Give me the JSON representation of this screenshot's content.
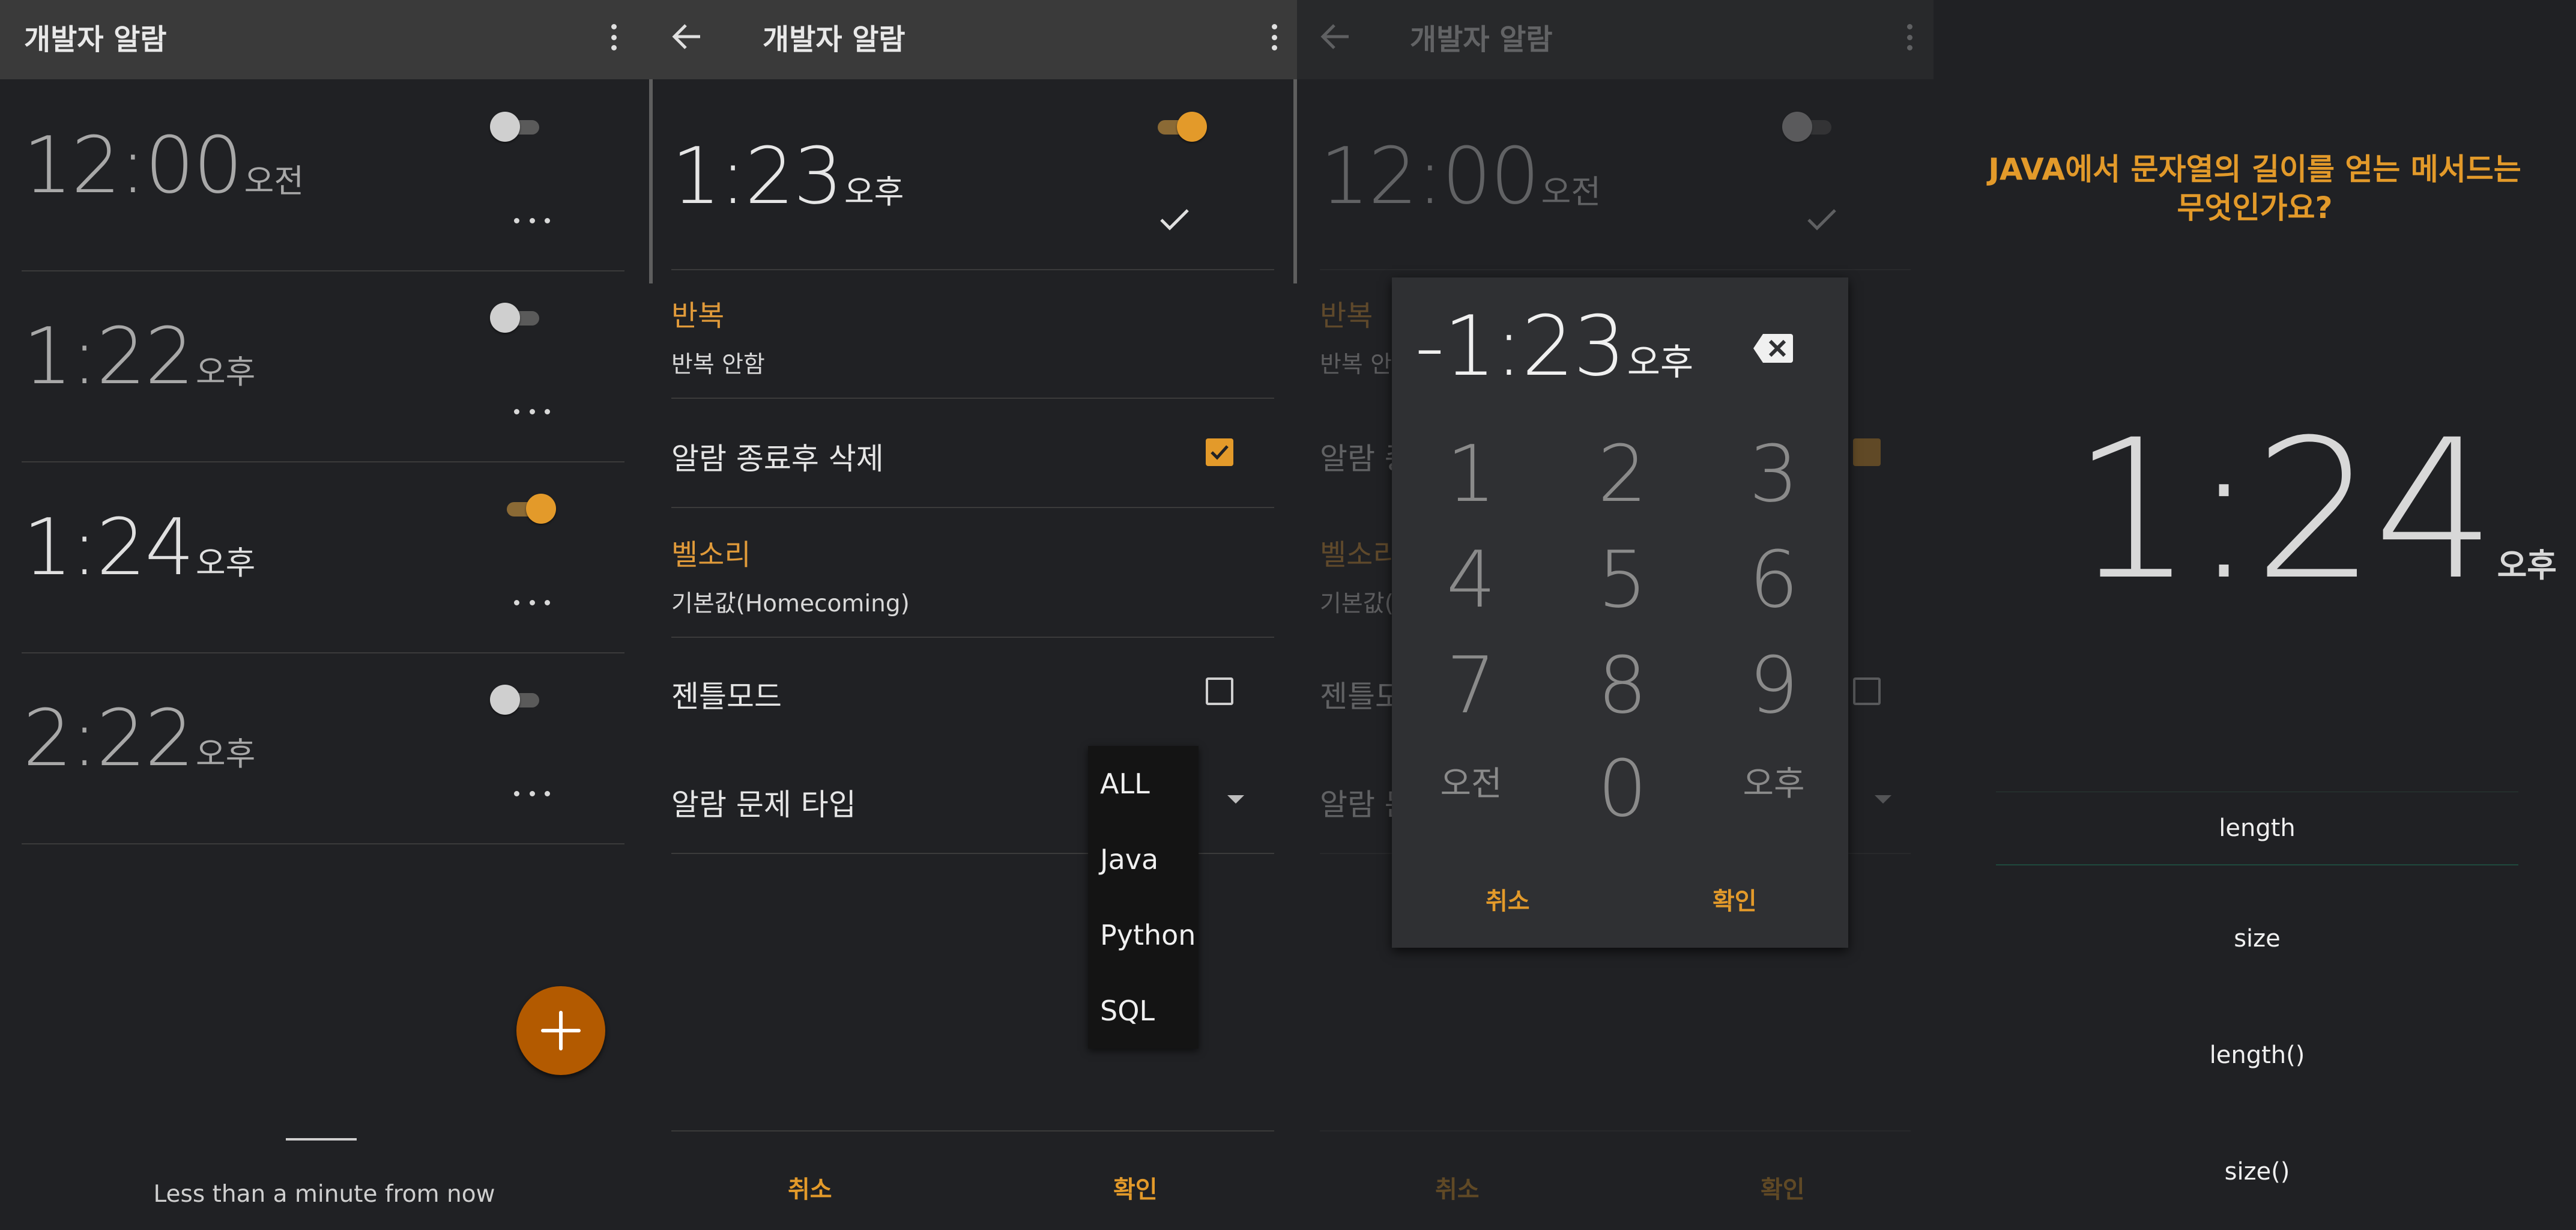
{
  "panel1": {
    "title": "개발자 알람",
    "alarms": [
      {
        "time": "12:00",
        "ampm": "오전",
        "enabled": false
      },
      {
        "time": "1:22",
        "ampm": "오후",
        "enabled": false
      },
      {
        "time": "1:24",
        "ampm": "오후",
        "enabled": true
      },
      {
        "time": "2:22",
        "ampm": "오후",
        "enabled": false
      }
    ],
    "footer": "Less than a minute from now"
  },
  "panel2": {
    "title": "개발자 알람",
    "time": "1:23",
    "ampm": "오후",
    "enabled": true,
    "repeat_label": "반복",
    "repeat_value": "반복 안함",
    "delete_label": "알람 종료후 삭제",
    "delete_checked": true,
    "ringtone_label": "벨소리",
    "ringtone_value": "기본값(Homecoming)",
    "gentle_label": "젠틀모드",
    "gentle_checked": false,
    "problem_type_label": "알람 문제 타입",
    "problem_type_options": [
      "ALL",
      "Java",
      "Python",
      "SQL"
    ],
    "cancel": "취소",
    "confirm": "확인"
  },
  "panel3": {
    "title": "개발자 알람",
    "bg_time": "12:00",
    "bg_ampm": "오전",
    "bg_repeat_label": "반복",
    "bg_repeat_value": "반복 안",
    "bg_delete_label": "알람 종",
    "bg_ringtone_label": "벨소리",
    "bg_ringtone_value": "기본값(",
    "bg_gentle_label": "젠틀모드",
    "bg_problem_label": "알람 문",
    "bg_cancel": "취소",
    "bg_confirm": "확인",
    "picker": {
      "display": "-1:23",
      "ampm": "오후",
      "keys": [
        "1",
        "2",
        "3",
        "4",
        "5",
        "6",
        "7",
        "8",
        "9",
        "오전",
        "0",
        "오후"
      ],
      "cancel": "취소",
      "confirm": "확인"
    }
  },
  "panel4": {
    "question_line1": "JAVA에서 문자열의 길이를 얻는 메서드는",
    "question_line2": "무엇인가요?",
    "time": "1:24",
    "ampm": "오후",
    "answers": [
      "length",
      "size",
      "length()",
      "size()"
    ]
  },
  "colors": {
    "accent": "#e39a2a",
    "fab": "#b35a00",
    "background": "#202124",
    "appbar": "#3a3a3a"
  }
}
